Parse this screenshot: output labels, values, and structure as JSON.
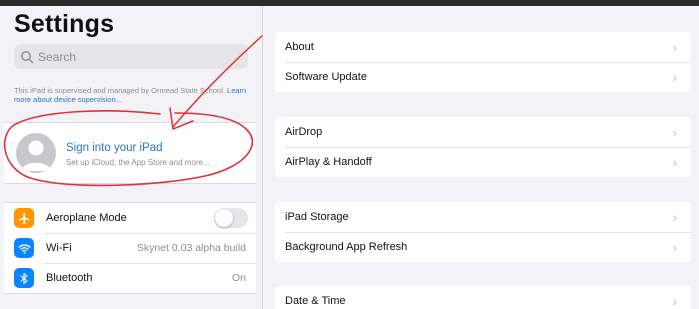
{
  "sidebar": {
    "title": "Settings",
    "search_placeholder": "Search",
    "supervised_text": "This iPad is supervised and managed by Ormead State School.",
    "supervised_link": "Learn more about device supervision...",
    "signin": {
      "title": "Sign into your iPad",
      "subtitle": "Set up iCloud, the App Store and more..."
    },
    "items": [
      {
        "label": "Aeroplane Mode",
        "icon": "airplane-icon",
        "color": "#ff9500",
        "value": ""
      },
      {
        "label": "Wi-Fi",
        "icon": "wifi-icon",
        "color": "#0a84ff",
        "value": "Skynet 0.03 alpha build"
      },
      {
        "label": "Bluetooth",
        "icon": "bluetooth-icon",
        "color": "#0a84ff",
        "value": "On"
      }
    ]
  },
  "detail": {
    "groups": [
      {
        "rows": [
          "About",
          "Software Update"
        ]
      },
      {
        "rows": [
          "AirDrop",
          "AirPlay & Handoff"
        ]
      },
      {
        "rows": [
          "iPad Storage",
          "Background App Refresh"
        ]
      },
      {
        "rows": [
          "Date & Time"
        ]
      }
    ]
  },
  "annotation_color": "#e0303a"
}
